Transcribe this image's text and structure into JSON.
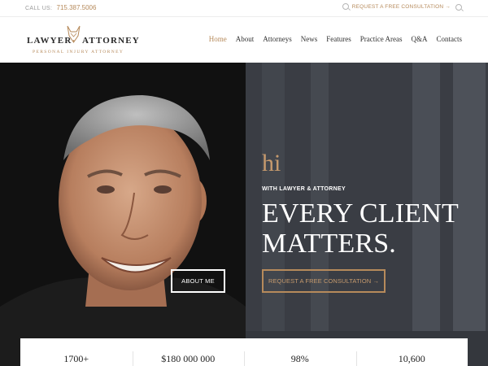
{
  "topbar": {
    "call_label": "CALL US:",
    "phone": "715.387.5006",
    "consult_link": "REQUEST A FREE CONSULTATION →"
  },
  "header": {
    "logo_word_left": "LAWYER",
    "logo_word_right": "ATTORNEY",
    "logo_tagline": "PERSONAL INJURY ATTORNEY",
    "nav": [
      "Home",
      "About",
      "Attorneys",
      "News",
      "Features",
      "Practice Areas",
      "Q&A",
      "Contacts"
    ],
    "active_nav": "Home"
  },
  "hero": {
    "greeting": "hi",
    "welcome": "WITH LAWYER & ATTORNEY",
    "headline_line1": "EVERY CLIENT",
    "headline_line2": "MATTERS.",
    "about_button": "ABOUT ME",
    "consult_button": "REQUEST A FREE CONSULTATION →"
  },
  "stats": [
    "1700+",
    "$180 000 000",
    "98%",
    "10,600"
  ],
  "colors": {
    "accent": "#b68a5b",
    "dark_panel": "#3a3d44",
    "photo_bg": "#121212"
  },
  "icons": [
    "search-icon",
    "fox-logo-icon"
  ]
}
